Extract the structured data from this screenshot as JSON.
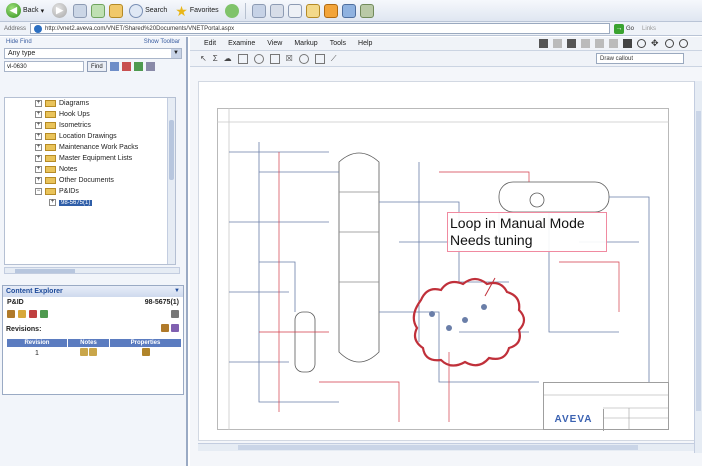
{
  "toolbar": {
    "back_label": "Back",
    "search_label": "Search",
    "favorites_label": "Favorites"
  },
  "address": {
    "label": "Address",
    "url": "http://vnet2.aveva.com/VNET/Shared%20Documents/VNETPortal.aspx",
    "go_label": "Go",
    "links_label": "Links"
  },
  "left_pane": {
    "hide_find": "Hide Find",
    "show_toolbar": "Show Toolbar",
    "dropdown_value": "Any type",
    "find_input": "vl-0630",
    "find_button": "Find",
    "tree": [
      {
        "label": "Diagrams"
      },
      {
        "label": "Hook Ups"
      },
      {
        "label": "Isometrics"
      },
      {
        "label": "Location Drawings"
      },
      {
        "label": "Maintenance Work Packs"
      },
      {
        "label": "Master Equipment Lists"
      },
      {
        "label": "Notes"
      },
      {
        "label": "Other Documents"
      },
      {
        "label": "P&IDs"
      }
    ],
    "tree_selected": "98-5675(1)"
  },
  "content_explorer": {
    "title": "Content Explorer",
    "doc_type": "P&ID",
    "doc_number": "98-5675(1)",
    "revisions_label": "Revisions:",
    "columns": [
      "Revision",
      "Notes",
      "Properties"
    ],
    "rows": [
      {
        "revision": "1"
      }
    ]
  },
  "viewer": {
    "menus": [
      "Edit",
      "Examine",
      "View",
      "Markup",
      "Tools",
      "Help"
    ],
    "draw_callout": "Draw callout"
  },
  "callout": {
    "line1": "Loop in Manual Mode",
    "line2": "Needs tuning"
  },
  "title_block": {
    "logo": "AVEVA"
  },
  "colors": {
    "redline": "#d23a48",
    "drawing_line": "#6a7ea8",
    "aveva_blue": "#3b62b2"
  }
}
